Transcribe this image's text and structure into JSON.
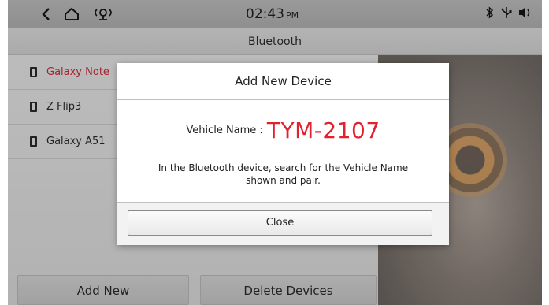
{
  "status_bar": {
    "back_icon": "chevron-left-icon",
    "home_icon": "home-icon",
    "location_icon": "location-signal-icon",
    "time": "02:43",
    "ampm": "PM",
    "bluetooth_icon": "bluetooth-icon",
    "usb_icon": "usb-icon",
    "volume_icon": "volume-icon"
  },
  "title": "Bluetooth",
  "devices": [
    {
      "label": "Galaxy Note",
      "active": true,
      "icon": "phone-icon"
    },
    {
      "label": "Z Flip3",
      "active": false,
      "icon": "phone-icon"
    },
    {
      "label": "Galaxy A51",
      "active": false,
      "icon": "phone-icon"
    }
  ],
  "buttons": {
    "add_new": "Add New",
    "delete_devices": "Delete Devices"
  },
  "dialog": {
    "title": "Add New Device",
    "vehicle_label": "Vehicle Name :",
    "vehicle_name": "TYM-2107",
    "message": "In the Bluetooth device, search for the Vehicle Name shown and pair.",
    "close_label": "Close"
  },
  "colors": {
    "accent_red": "#e3202e",
    "active_item_red": "#b3202b"
  }
}
